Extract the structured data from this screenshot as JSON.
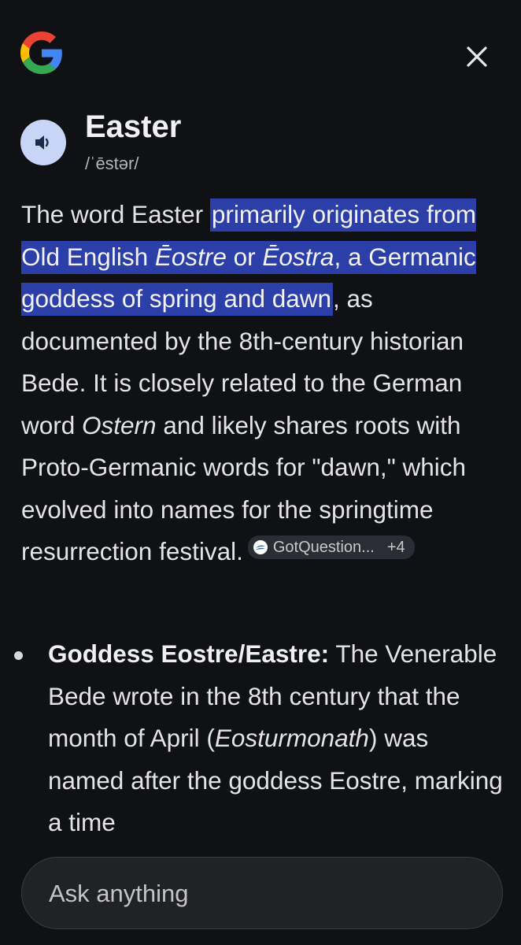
{
  "header": {
    "logo_icon": "google-g-icon",
    "close_icon": "close-icon",
    "colors": {
      "blue": "#4285F4",
      "red": "#EA4335",
      "yellow": "#FBBC05",
      "green": "#34A853"
    }
  },
  "word": {
    "speaker_icon": "speaker-icon",
    "title": "Easter",
    "phonetic": "/ˈēstər/"
  },
  "answer": {
    "intro": "The word Easter ",
    "highlight_1": "primarily originates from Old English ",
    "italic_1": "Ēostre",
    "highlight_2": " or ",
    "italic_2": "Ēostra",
    "highlight_3": ", a Germanic goddess of spring and dawn",
    "rest_1": ", as documented by the 8th-century historian Bede. It is closely related to the German word ",
    "italic_3": "Ostern",
    "rest_2": " and likely shares roots with Proto-Germanic words for \"dawn,\" which evolved into names for the springtime resurrection festival.",
    "highlight_color": "#2c3fa8",
    "citation": {
      "icon": "source-favicon-icon",
      "label": "GotQuestion...",
      "count": "+4"
    }
  },
  "bullets": [
    {
      "title": "Goddess Eostre/Eastre:",
      "text_1": " The Venerable Bede wrote in the 8th century that the month of April (",
      "italic": "Eosturmonath",
      "text_2": ") was named after the goddess Eostre, marking a time"
    }
  ],
  "ask": {
    "placeholder": "Ask anything"
  }
}
